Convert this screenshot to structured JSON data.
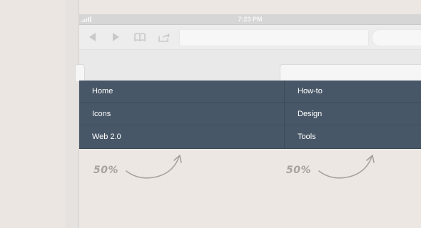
{
  "status_bar": {
    "time": "7:23 PM"
  },
  "toolbar": {
    "icons": [
      "back-icon",
      "forward-icon",
      "bookmarks-icon",
      "share-icon"
    ],
    "url_value": "",
    "search_value": ""
  },
  "menu": {
    "left": [
      {
        "label": "Home"
      },
      {
        "label": "Icons"
      },
      {
        "label": "Web 2.0"
      }
    ],
    "right": [
      {
        "label": "How-to"
      },
      {
        "label": "Design"
      },
      {
        "label": "Tools"
      }
    ]
  },
  "annotations": [
    {
      "text": "50%"
    },
    {
      "text": "50%"
    }
  ],
  "colors": {
    "menu_bg": "#485767",
    "page_bg": "#ece7e3",
    "annotation": "#a8a29c"
  }
}
